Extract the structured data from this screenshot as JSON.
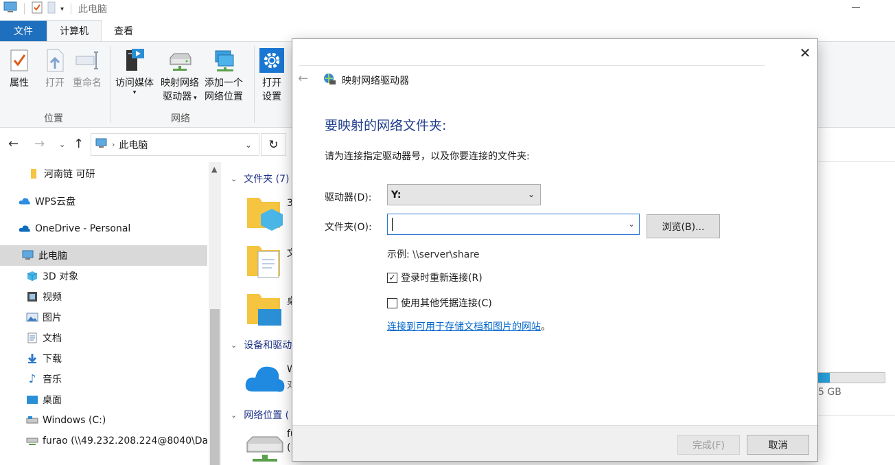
{
  "titlebar": {
    "title": "此电脑"
  },
  "ribbon_tabs": [
    {
      "label": "文件"
    },
    {
      "label": "计算机"
    },
    {
      "label": "查看"
    }
  ],
  "ribbon": {
    "properties": "属性",
    "open": "打开",
    "rename": "重命名",
    "access_media": "访问媒体",
    "map_drive_line1": "映射网络",
    "map_drive_line2": "驱动器",
    "add_location_line1": "添加一个",
    "add_location_line2": "网络位置",
    "open_settings_line1": "打开",
    "open_settings_line2": "设置",
    "group_location": "位置",
    "group_network": "网络"
  },
  "address": {
    "path": "此电脑"
  },
  "nav": {
    "items": [
      {
        "label": "河南链 可研"
      },
      {
        "label": "WPS云盘"
      },
      {
        "label": "OneDrive - Personal"
      },
      {
        "label": "此电脑"
      },
      {
        "label": "3D 对象"
      },
      {
        "label": "视频"
      },
      {
        "label": "图片"
      },
      {
        "label": "文档"
      },
      {
        "label": "下载"
      },
      {
        "label": "音乐"
      },
      {
        "label": "桌面"
      },
      {
        "label": "Windows (C:)"
      },
      {
        "label": "furao (\\\\49.232.208.224@8040\\Da"
      }
    ]
  },
  "content": {
    "sections": [
      {
        "label": "文件夹 (7)"
      },
      {
        "label": "设备和驱动"
      },
      {
        "label": "网络位置 ("
      }
    ],
    "item_partial": [
      "3",
      "文",
      "桌",
      "W",
      "对",
      "fu",
      "("
    ],
    "storage_text": "5 GB"
  },
  "dialog": {
    "title": "映射网络驱动器",
    "heading": "要映射的网络文件夹:",
    "description": "请为连接指定驱动器号，以及你要连接的文件夹:",
    "drive_label": "驱动器(D):",
    "drive_value": "Y:",
    "folder_label": "文件夹(O):",
    "folder_value": "",
    "browse_label": "浏览(B)...",
    "example": "示例: \\\\server\\share",
    "reconnect_label": "登录时重新连接(R)",
    "reconnect_checked": true,
    "other_creds_label": "使用其他凭据连接(C)",
    "other_creds_checked": false,
    "link": "连接到可用于存储文档和图片的网站",
    "link_suffix": "。",
    "finish_label": "完成(F)",
    "cancel_label": "取消"
  },
  "colors": {
    "file_tab": "#1e6fbd",
    "heading": "#1e3c8c",
    "link": "#0066cc",
    "selection": "#d9d9d9"
  }
}
